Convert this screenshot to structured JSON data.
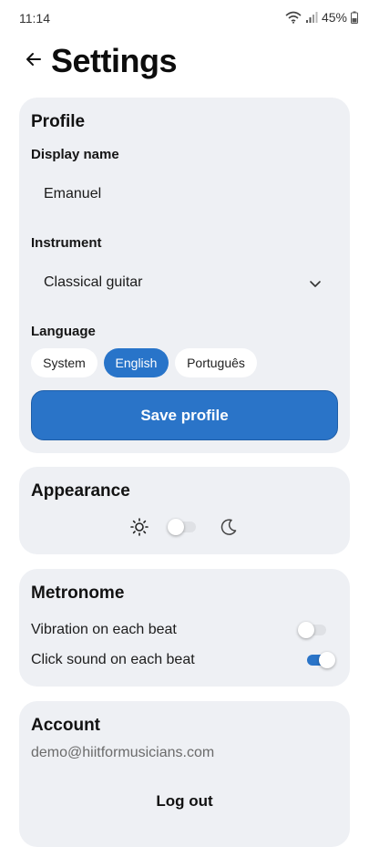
{
  "status_bar": {
    "time": "11:14",
    "battery": "45%"
  },
  "header": {
    "title": "Settings",
    "back_icon": "arrow-left-icon"
  },
  "profile": {
    "title": "Profile",
    "display_name_label": "Display name",
    "display_name_value": "Emanuel",
    "instrument_label": "Instrument",
    "instrument_value": "Classical guitar",
    "language_label": "Language",
    "languages": [
      "System",
      "English",
      "Português"
    ],
    "selected_language": "English",
    "save_label": "Save profile"
  },
  "appearance": {
    "title": "Appearance",
    "light_icon": "sun-icon",
    "dark_icon": "moon-icon",
    "dark_mode_enabled": false
  },
  "metronome": {
    "title": "Metronome",
    "vibration_label": "Vibration on each beat",
    "vibration_enabled": false,
    "click_label": "Click sound on each beat",
    "click_enabled": true
  },
  "account": {
    "title": "Account",
    "email": "demo@hiitformusicians.com",
    "logout_label": "Log out"
  },
  "colors": {
    "accent": "#2874c9",
    "card_bg": "#eef0f4",
    "toggle_off_track": "#dfe1e5",
    "toggle_on_track": "#2a74c8"
  }
}
